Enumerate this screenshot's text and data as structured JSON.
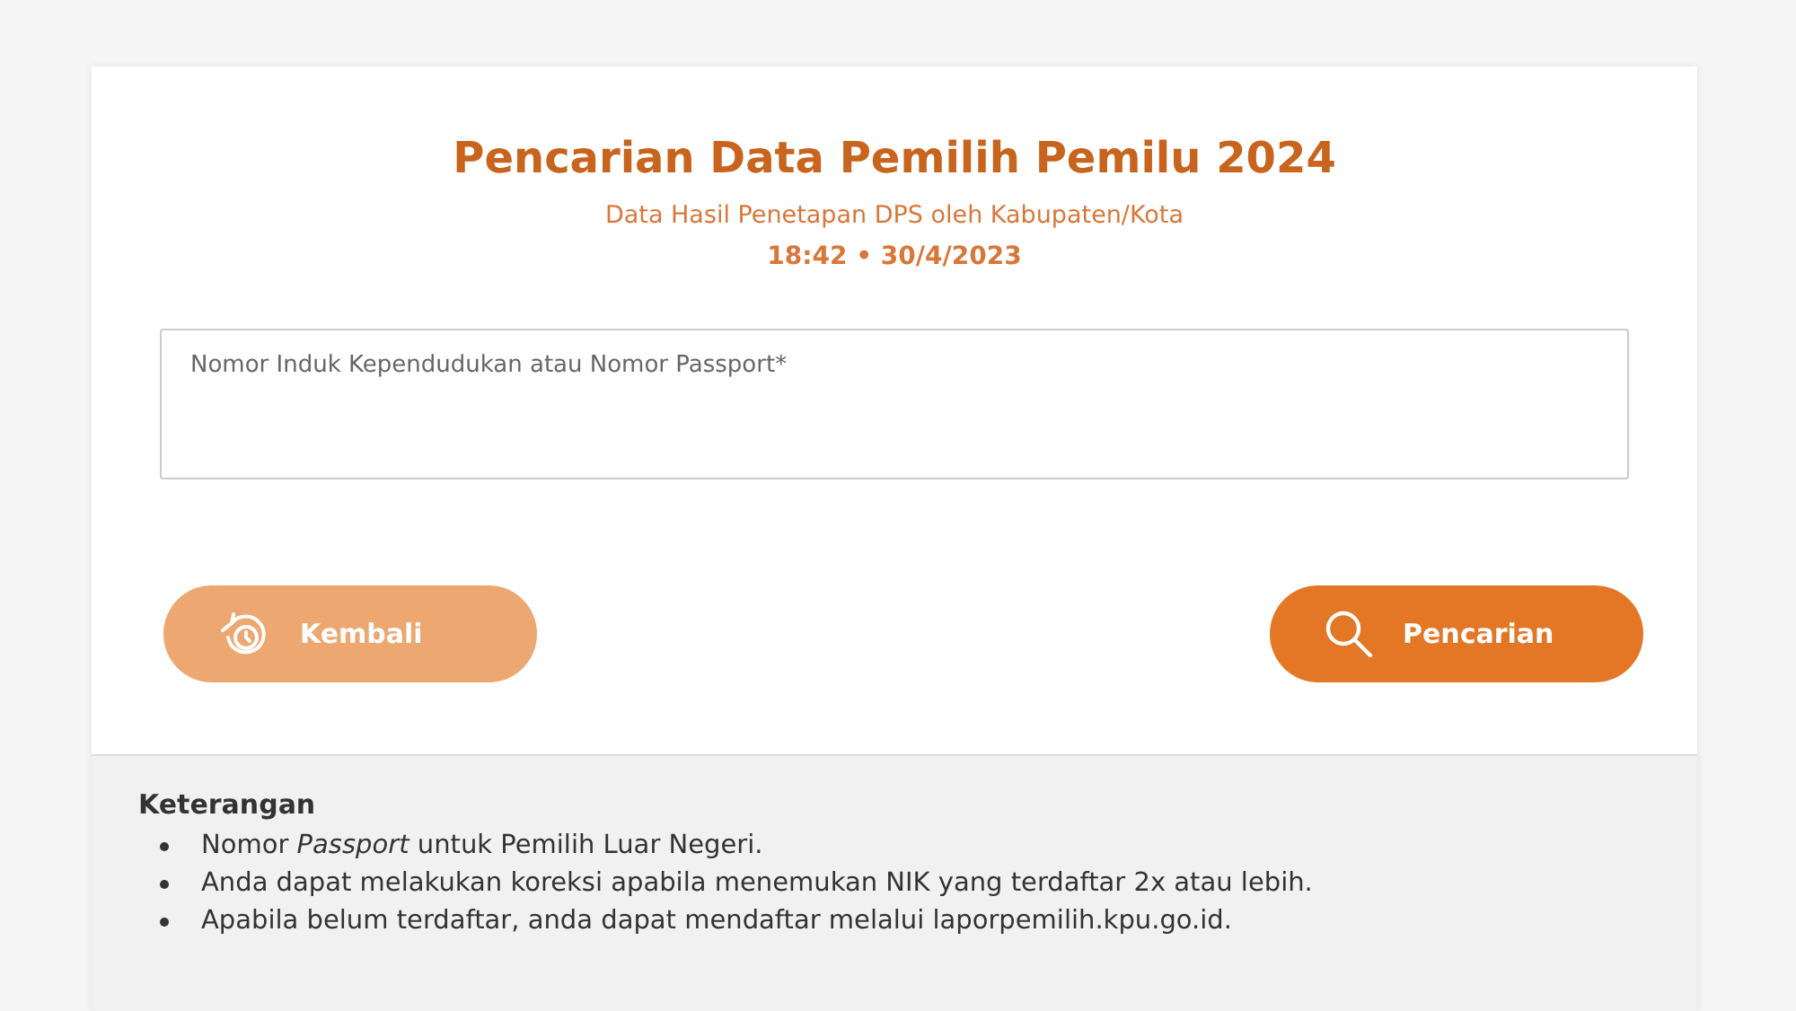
{
  "title": "Pencarian Data Pemilih Pemilu 2024",
  "subtitle": "Data Hasil Penetapan DPS oleh Kabupaten/Kota",
  "timestamp": "18:42 • 30/4/2023",
  "search": {
    "placeholder": "Nomor Induk Kependudukan atau Nomor Passport*"
  },
  "buttons": [
    {
      "label": "Kembali",
      "kind": "back"
    },
    {
      "label": "Pencarian",
      "kind": "search"
    }
  ],
  "notes": {
    "heading": "Keterangan",
    "items": [
      "Nomor *Passport* untuk Pemilih Luar Negeri.",
      "Anda dapat melakukan koreksi apabila menemukan NIK yang terdaftar 2x atau lebih.",
      "Apabila belum terdaftar, anda dapat mendaftar melalui laporpemilih.kpu.go.id."
    ]
  }
}
